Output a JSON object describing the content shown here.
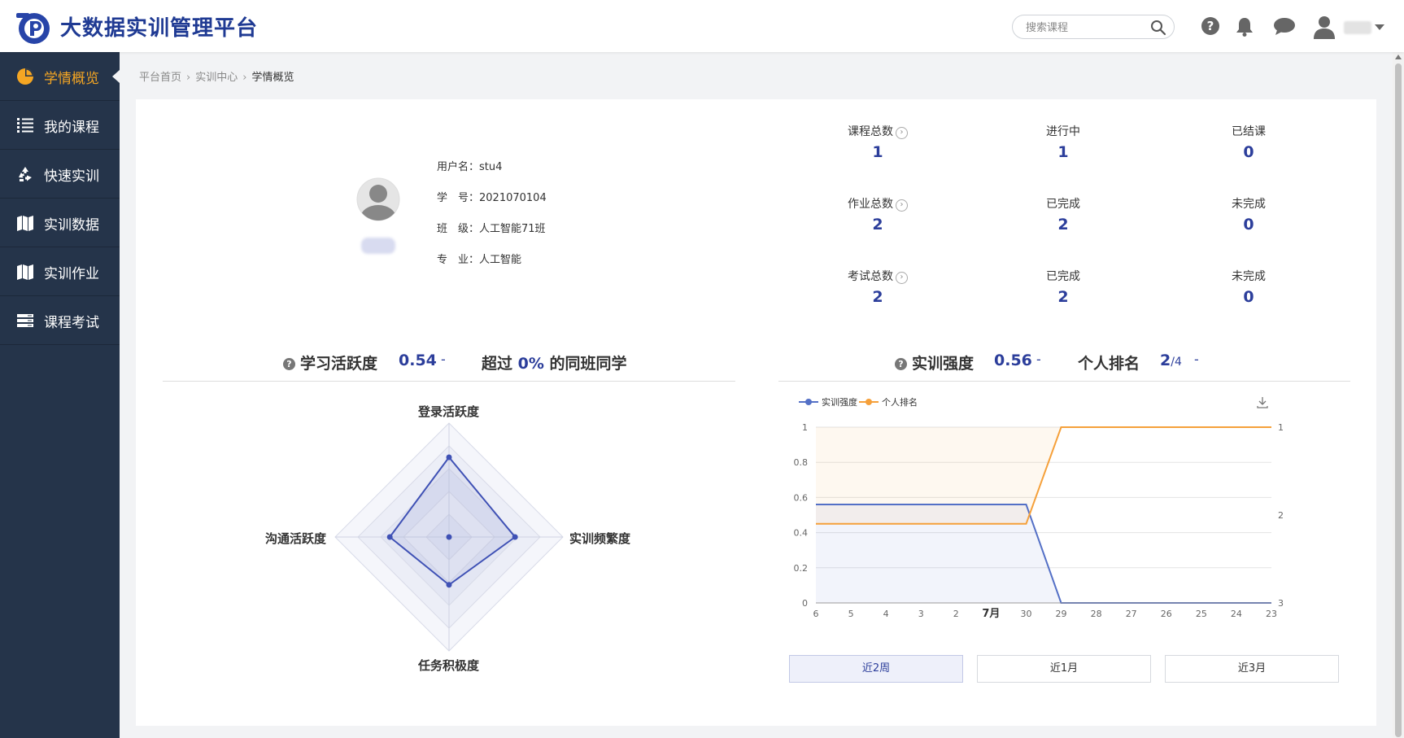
{
  "header": {
    "app_title": "大数据实训管理平台",
    "search_placeholder": "搜索课程",
    "icons": [
      "help-icon",
      "bell-icon",
      "chat-icon",
      "user-avatar-icon",
      "caret-down-icon"
    ]
  },
  "sidebar": {
    "items": [
      {
        "label": "学情概览",
        "icon": "pie-chart-icon",
        "active": true
      },
      {
        "label": "我的课程",
        "icon": "list-icon",
        "active": false
      },
      {
        "label": "快速实训",
        "icon": "recycle-icon",
        "active": false
      },
      {
        "label": "实训数据",
        "icon": "map-icon",
        "active": false
      },
      {
        "label": "实训作业",
        "icon": "map-icon",
        "active": false
      },
      {
        "label": "课程考试",
        "icon": "server-icon",
        "active": false
      }
    ]
  },
  "breadcrumb": {
    "items": [
      "平台首页",
      "实训中心",
      "学情概览"
    ]
  },
  "profile": {
    "username_label": "用户名：",
    "username": "stu4",
    "student_id_label": "学　号：",
    "student_id": "2021070104",
    "class_label": "班　级：",
    "class": "人工智能71班",
    "major_label": "专　业：",
    "major": "人工智能"
  },
  "stats": {
    "rows": [
      [
        {
          "label": "课程总数",
          "value": "1",
          "link": true
        },
        {
          "label": "进行中",
          "value": "1"
        },
        {
          "label": "已结课",
          "value": "0"
        }
      ],
      [
        {
          "label": "作业总数",
          "value": "2",
          "link": true
        },
        {
          "label": "已完成",
          "value": "2"
        },
        {
          "label": "未完成",
          "value": "0"
        }
      ],
      [
        {
          "label": "考试总数",
          "value": "2",
          "link": true
        },
        {
          "label": "已完成",
          "value": "2"
        },
        {
          "label": "未完成",
          "value": "0"
        }
      ]
    ]
  },
  "activity": {
    "title": "学习活跃度",
    "value": "0.54",
    "dash": "-",
    "exceed_prefix": "超过",
    "exceed_value": "0%",
    "exceed_suffix": "的同班同学",
    "radar": {
      "axes": [
        "登录活跃度",
        "实训频繁度",
        "任务积极度",
        "沟通活跃度"
      ],
      "values": [
        0.7,
        0.58,
        0.42,
        0.52
      ],
      "max": 1,
      "rings": 5,
      "line_color": "#3f51b5"
    }
  },
  "training": {
    "title": "实训强度",
    "value": "0.56",
    "dash": "-",
    "rank_title": "个人排名",
    "rank_value": "2",
    "rank_total": "/4",
    "rank_dash": "-"
  },
  "chart_data": {
    "type": "line",
    "legend": [
      "实训强度",
      "个人排名"
    ],
    "x": [
      "6",
      "5",
      "4",
      "3",
      "2",
      "7月",
      "30",
      "29",
      "28",
      "27",
      "26",
      "25",
      "24",
      "23"
    ],
    "series": [
      {
        "name": "实训强度",
        "color": "#5470c6",
        "axis": "left",
        "area": true,
        "values": [
          0.56,
          0.56,
          0.56,
          0.56,
          0.56,
          0.56,
          0.56,
          0,
          0,
          0,
          0,
          0,
          0,
          0
        ]
      },
      {
        "name": "个人排名",
        "color": "#f5a03a",
        "axis": "right",
        "area": true,
        "values": [
          2.1,
          2.1,
          2.1,
          2.1,
          2.1,
          2.1,
          2.1,
          1,
          1,
          1,
          1,
          1,
          1,
          1
        ]
      }
    ],
    "y_left": {
      "min": 0,
      "max": 1,
      "ticks": [
        "0",
        "0.2",
        "0.4",
        "0.6",
        "0.8",
        "1"
      ]
    },
    "y_right": {
      "min": 1,
      "max": 3,
      "inverse": true,
      "ticks": [
        "1",
        "2",
        "3"
      ]
    },
    "grid": true,
    "legend_position": "top-left",
    "download_icon": "download-icon"
  },
  "range_buttons": [
    {
      "label": "近2周",
      "active": true
    },
    {
      "label": "近1月",
      "active": false
    },
    {
      "label": "近3月",
      "active": false
    }
  ]
}
